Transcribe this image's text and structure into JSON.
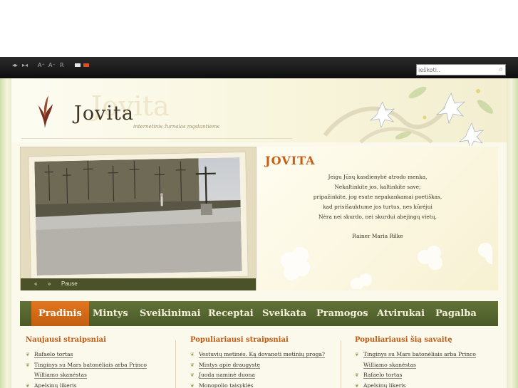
{
  "topbar": {
    "size_controls": [
      "A⁺",
      "A⁻",
      "R"
    ],
    "search_placeholder": "ieškoti.."
  },
  "header": {
    "logo": "Jovita",
    "logo_watermark": "Jovita",
    "tagline": "internetinis žurnalas mąstantiems"
  },
  "slider": {
    "prev": "«",
    "next": "»",
    "pause": "Pause"
  },
  "quote": {
    "title": "JOVITA",
    "lines": [
      "Jeigu Jūsų kasdienybė atrodo menka,",
      "Nekaltinkite jos, kaltinkite save;",
      "pripažinkite, jog esate nepakankamai poetiškas,",
      "kad prisišauktume jos turtus, nes kūrėjui",
      "Nėra nei skurdo, nei skurdui abejingų vietų."
    ],
    "author": "Rainer Maria Rilke"
  },
  "nav": {
    "items": [
      "Pradinis",
      "Mintys",
      "Sveikinimai",
      "Receptai",
      "Sveikata",
      "Pramogos",
      "Atvirukai",
      "Pagalba"
    ]
  },
  "columns": [
    {
      "title": "Naujausi straipsniai",
      "items": [
        "Rafaelo tortas",
        "Tinginys su Mars batonėliais arba Princo",
        "Williamo skanėstas",
        "Apelsinų likeris"
      ]
    },
    {
      "title": "Populiariausi straipsniai",
      "items": [
        "Vestuvių metinės. Ką dovanoti metinių proga?",
        "Mintys apie draugystę",
        "Juoda naminė duona",
        "Monopolio taisyklės"
      ]
    },
    {
      "title": "Populiariausi šią savaitę",
      "items": [
        "Tinginys su Mars batonėliais arba Princo",
        "Williamo skanėstas",
        "Rafaelo tortas",
        "Apelsinų likeris"
      ]
    }
  ],
  "colors": {
    "accent": "#c55e14",
    "nav_bg": "#4a5a28",
    "nav_active": "#d46a18"
  }
}
